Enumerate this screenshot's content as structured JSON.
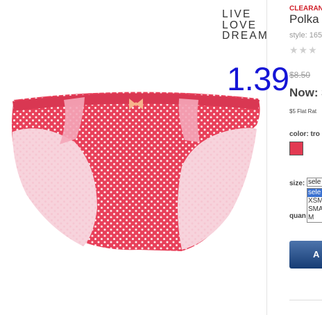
{
  "product_image": {
    "logo_lines": [
      "LIVE",
      "LOVE",
      "DREAM"
    ],
    "description": "Pink polka dot bikini panty with lace side trim and bow"
  },
  "price_overlay": "1.39",
  "product": {
    "badge": "CLEARANC",
    "title": "Polka",
    "style": "style: 165",
    "stars": "★★★",
    "was_price": "$8.50",
    "now_label": "Now:",
    "now_price": "$",
    "shipping": "$5 Flat Rat",
    "color_label": "color: tro",
    "swatch_color": "#e23a52",
    "size_label": "size:",
    "size_selected": "sele",
    "size_options": [
      "sele",
      "XSM",
      "SMA",
      "M"
    ],
    "quantity_label": "quan",
    "add_button": "A"
  }
}
